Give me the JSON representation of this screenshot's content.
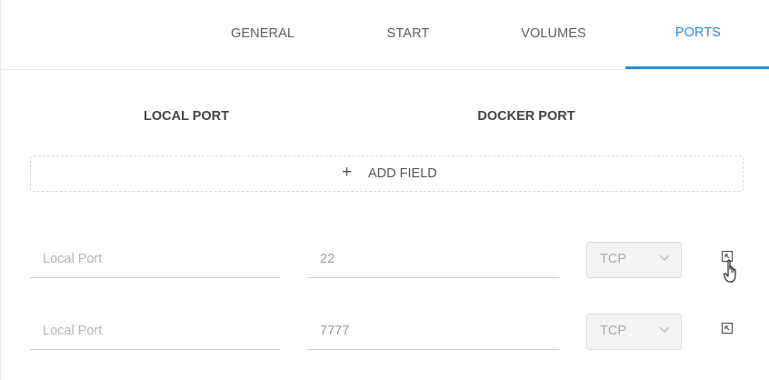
{
  "tabs": [
    {
      "label": "GENERAL",
      "active": false
    },
    {
      "label": "START",
      "active": false
    },
    {
      "label": "VOLUMES",
      "active": false
    },
    {
      "label": "PORTS",
      "active": true
    }
  ],
  "colors": {
    "accent": "#2b8be0",
    "text": "#606060",
    "placeholder": "#b5b5b5"
  },
  "columns": {
    "local": "LOCAL PORT",
    "docker": "DOCKER PORT"
  },
  "add_field": {
    "icon": "plus-icon",
    "label": "ADD FIELD"
  },
  "rows": [
    {
      "local_value": "",
      "local_placeholder": "Local Port",
      "docker_value": "22",
      "protocol": "TCP",
      "remove_icon": "remove-icon"
    },
    {
      "local_value": "",
      "local_placeholder": "Local Port",
      "docker_value": "7777",
      "protocol": "TCP",
      "remove_icon": "remove-icon"
    }
  ]
}
